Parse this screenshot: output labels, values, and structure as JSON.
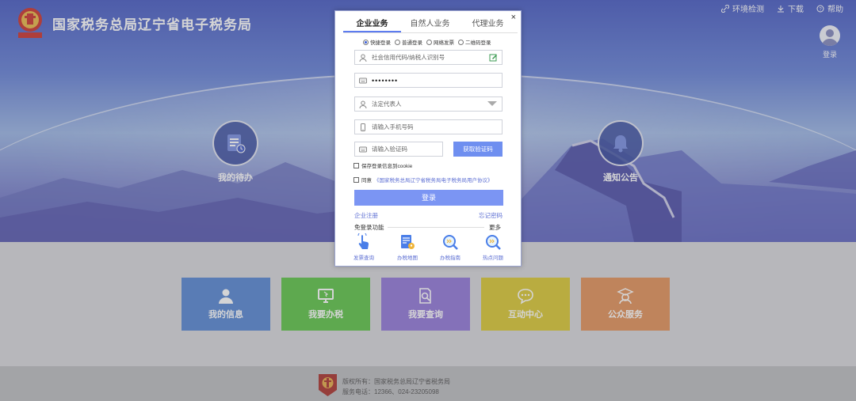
{
  "header": {
    "site_title": "国家税务总局辽宁省电子税务局",
    "top_links": [
      "环境检测",
      "下载",
      "帮助"
    ],
    "login_label": "登录"
  },
  "hero": {
    "todo_label": "我的待办",
    "notice_label": "通知公告"
  },
  "tiles": [
    {
      "label": "我的信息",
      "color": "#4a7ed0"
    },
    {
      "label": "我要办税",
      "color": "#52c03a"
    },
    {
      "label": "我要查询",
      "color": "#8a6dd6"
    },
    {
      "label": "互动中心",
      "color": "#d7c424"
    },
    {
      "label": "公众服务",
      "color": "#e08a4d"
    }
  ],
  "footer": {
    "line1": "版权所有：国家税务总局辽宁省税务局",
    "line2": "服务电话：12366、024-23205098"
  },
  "modal": {
    "close": "×",
    "tabs": [
      "企业业务",
      "自然人业务",
      "代理业务"
    ],
    "radios": [
      "快捷登录",
      "普通登录",
      "网络发票",
      "二维码登录"
    ],
    "fields": {
      "credit_code_placeholder": "社会信用代码/纳税人识别号",
      "password_value": "••••••••",
      "role_placeholder": "法定代表人",
      "phone_placeholder": "请输入手机号码",
      "code_placeholder": "请输入验证码"
    },
    "get_code_button": "获取验证码",
    "save_cookie": "保存登录信息到cookie",
    "agree_prefix": "同意",
    "agree_link": "《国家税务总局辽宁省税务局电子税务局用户协议》",
    "login_button": "登录",
    "register_link": "企业注册",
    "forgot_link": "忘记密码",
    "no_login_title": "免登录功能",
    "more": "更多",
    "quick_items": [
      "发票查询",
      "办税地图",
      "办税指南",
      "热点问题"
    ]
  },
  "colors": {
    "accent": "#6f8ff0",
    "login_button": "#7b95f3",
    "link": "#5d6fd3"
  }
}
